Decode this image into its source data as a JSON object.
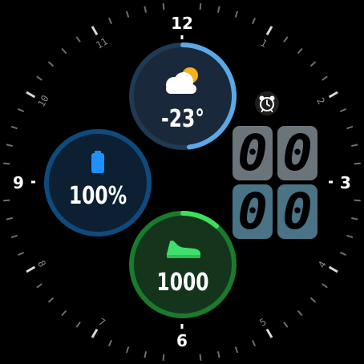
{
  "dial": {
    "major_numbers": [
      "12",
      "3",
      "6",
      "9"
    ],
    "minor_numbers": [
      "1",
      "2",
      "4",
      "5",
      "7",
      "8",
      "10",
      "11"
    ]
  },
  "weather": {
    "icon": "partly-cloudy-icon",
    "temperature": "-23°"
  },
  "battery": {
    "icon": "battery-icon",
    "level": "100%",
    "level_fraction": 1.0
  },
  "steps": {
    "icon": "sneaker-icon",
    "count": "1000"
  },
  "alarm": {
    "icon": "alarm-clock-icon"
  },
  "time": {
    "hour_digits": [
      "0",
      "0"
    ],
    "minute_digits": [
      "0",
      "0"
    ]
  },
  "colors": {
    "background": "#000000",
    "weather_ring": "#1f3a52",
    "weather_ring_arc": "#5aa8e6",
    "weather_fill": "#19283a",
    "battery_ring": "#0e4a7c",
    "battery_fill": "#0c1f33",
    "battery_icon": "#1e90ff",
    "steps_ring": "#1a7a2e",
    "steps_ring_arc": "#3de05a",
    "steps_fill": "#14351c",
    "steps_icon": "#3de06a",
    "hour_digit_bg": "#6b7479",
    "minute_digit_bg": "#4a7385"
  }
}
